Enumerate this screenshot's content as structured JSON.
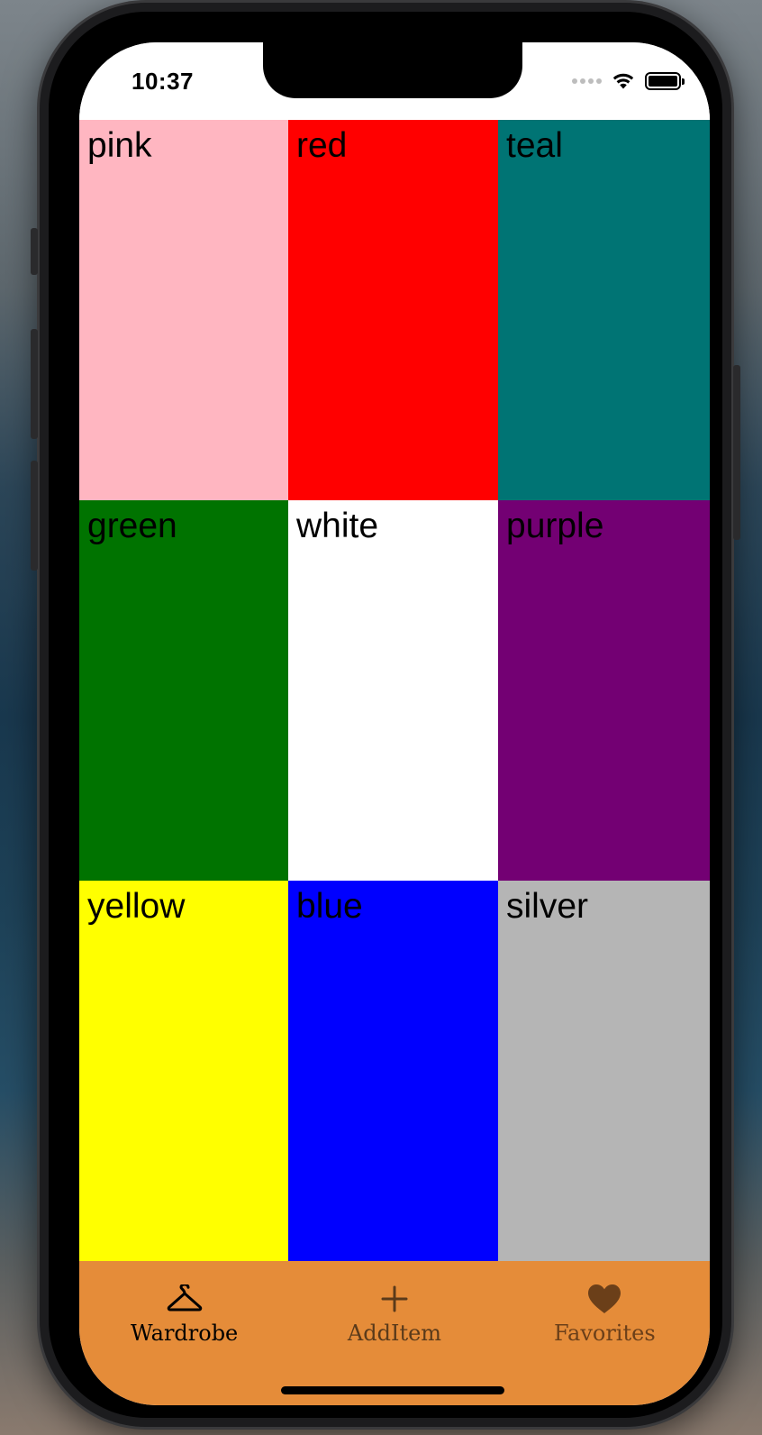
{
  "status_bar": {
    "time": "10:37"
  },
  "tiles": [
    {
      "label": "pink",
      "color": "#ffb6c1"
    },
    {
      "label": "red",
      "color": "#ff0000"
    },
    {
      "label": "teal",
      "color": "#007474"
    },
    {
      "label": "green",
      "color": "#007300"
    },
    {
      "label": "white",
      "color": "#ffffff"
    },
    {
      "label": "purple",
      "color": "#730073"
    },
    {
      "label": "yellow",
      "color": "#ffff00"
    },
    {
      "label": "blue",
      "color": "#0000ff"
    },
    {
      "label": "silver",
      "color": "#b5b5b5"
    }
  ],
  "tabbar": {
    "background": "#e58c39",
    "items": [
      {
        "label": "Wardrobe",
        "icon": "hanger-icon",
        "color": "#000000"
      },
      {
        "label": "AddItem",
        "icon": "plus-icon",
        "color": "#5a3a1a"
      },
      {
        "label": "Favorites",
        "icon": "heart-icon",
        "color": "#6b3f19"
      }
    ]
  }
}
